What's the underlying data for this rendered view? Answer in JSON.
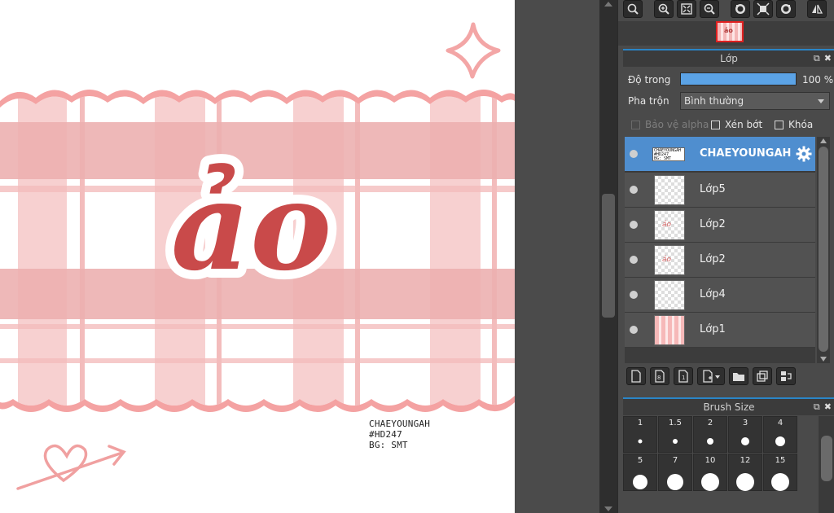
{
  "canvas": {
    "title_text": "ảo",
    "credits": [
      "CHAEYOUNGAH",
      "#HD247",
      "BG: SMT"
    ],
    "colors": {
      "plaid_light": "#f6c2c2",
      "plaid_mid": "#e7a8a8",
      "plaid_stroke": "#f29e9e",
      "title_fill": "#c94a4a",
      "heart_arrow": "#f0a0a0"
    }
  },
  "toolbar": {
    "icons": [
      "zoom-fit-icon",
      "zoom-in-icon",
      "fit-window-icon",
      "zoom-out-icon",
      "rotate-left-icon",
      "center-icon",
      "rotate-right-icon",
      "flip-icon"
    ]
  },
  "layer_panel": {
    "title": "Lớp",
    "opacity_label": "Độ trong",
    "opacity_value": "100 %",
    "opacity_fraction": 1.0,
    "blend_label": "Pha trộn",
    "blend_value": "Bình thường",
    "protect_alpha_label": "Bảo vệ alpha",
    "clipping_label": "Xén bớt",
    "lock_label": "Khóa",
    "layers": [
      {
        "name": "CHAEYOUNGAH",
        "active": true,
        "thumb": "text"
      },
      {
        "name": "Lớp5",
        "active": false,
        "thumb": "empty"
      },
      {
        "name": "Lớp2",
        "active": false,
        "thumb": "title"
      },
      {
        "name": "Lớp2",
        "active": false,
        "thumb": "title"
      },
      {
        "name": "Lớp4",
        "active": false,
        "thumb": "empty"
      },
      {
        "name": "Lớp1",
        "active": false,
        "thumb": "plaid"
      }
    ],
    "tools": [
      "new-layer-icon",
      "new-halftone-layer-icon",
      "new-1bit-layer-icon",
      "add-layer-menu-icon",
      "folder-icon",
      "duplicate-layer-icon",
      "merge-layer-icon"
    ]
  },
  "brush_panel": {
    "title": "Brush Size",
    "sizes": [
      "1",
      "1.5",
      "2",
      "3",
      "4",
      "5",
      "7",
      "10",
      "12",
      "15"
    ],
    "dot_diameters": [
      5,
      6,
      8,
      10,
      12,
      18,
      20,
      22,
      22,
      22
    ]
  }
}
